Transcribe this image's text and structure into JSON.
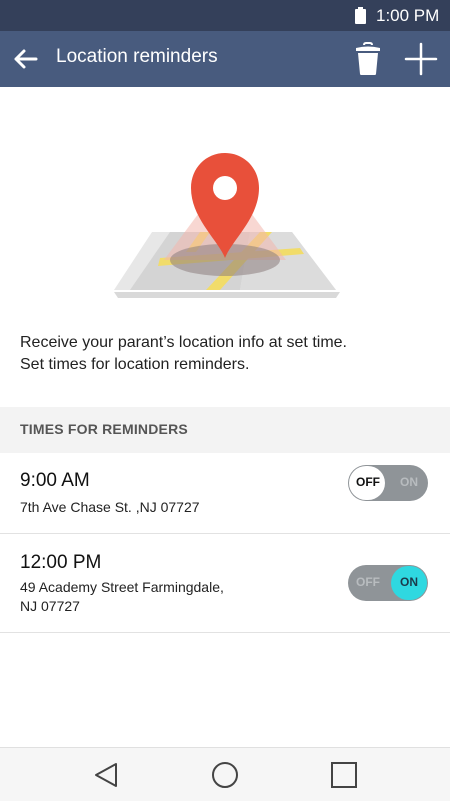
{
  "status_bar": {
    "time": "1:00 PM",
    "battery_icon": "battery-icon"
  },
  "app_bar": {
    "title": "Location reminders",
    "back_icon": "arrow-left-icon",
    "delete_icon": "trash-icon",
    "add_icon": "plus-icon",
    "background": "#485b7e"
  },
  "hero": {
    "icon": "map-pin-illustration",
    "pin_color": "#e8503a"
  },
  "description": {
    "line1": "Receive your parant’s location info at set time.",
    "line2": "Set times for location reminders."
  },
  "reminders_section": {
    "header": "TIMES FOR REMINDERS",
    "items": [
      {
        "time": "9:00 AM",
        "address_line1": "7th Ave Chase St. ,NJ 07727",
        "address_line2": "",
        "toggle_off_label": "OFF",
        "toggle_on_label": "ON",
        "enabled": false
      },
      {
        "time": "12:00 PM",
        "address_line1": "49 Academy Street Farmingdale,",
        "address_line2": "NJ 07727",
        "toggle_off_label": "OFF",
        "toggle_on_label": "ON",
        "enabled": true
      }
    ],
    "toggle_on_color": "#2fd8e0"
  },
  "nav_bar": {
    "back_icon": "triangle-back-icon",
    "home_icon": "circle-home-icon",
    "recents_icon": "square-recents-icon"
  }
}
